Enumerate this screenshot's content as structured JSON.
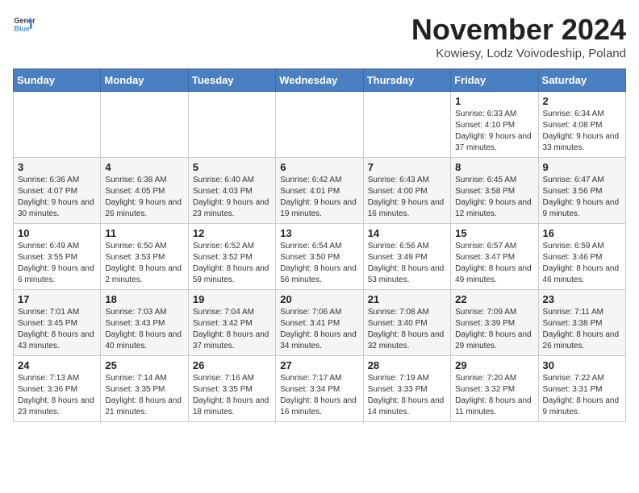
{
  "header": {
    "logo": "GeneralBlue",
    "title": "November 2024",
    "location": "Kowiesy, Lodz Voivodeship, Poland"
  },
  "days_of_week": [
    "Sunday",
    "Monday",
    "Tuesday",
    "Wednesday",
    "Thursday",
    "Friday",
    "Saturday"
  ],
  "weeks": [
    [
      {
        "day": "",
        "content": ""
      },
      {
        "day": "",
        "content": ""
      },
      {
        "day": "",
        "content": ""
      },
      {
        "day": "",
        "content": ""
      },
      {
        "day": "",
        "content": ""
      },
      {
        "day": "1",
        "content": "Sunrise: 6:33 AM\nSunset: 4:10 PM\nDaylight: 9 hours and 37 minutes."
      },
      {
        "day": "2",
        "content": "Sunrise: 6:34 AM\nSunset: 4:08 PM\nDaylight: 9 hours and 33 minutes."
      }
    ],
    [
      {
        "day": "3",
        "content": "Sunrise: 6:36 AM\nSunset: 4:07 PM\nDaylight: 9 hours and 30 minutes."
      },
      {
        "day": "4",
        "content": "Sunrise: 6:38 AM\nSunset: 4:05 PM\nDaylight: 9 hours and 26 minutes."
      },
      {
        "day": "5",
        "content": "Sunrise: 6:40 AM\nSunset: 4:03 PM\nDaylight: 9 hours and 23 minutes."
      },
      {
        "day": "6",
        "content": "Sunrise: 6:42 AM\nSunset: 4:01 PM\nDaylight: 9 hours and 19 minutes."
      },
      {
        "day": "7",
        "content": "Sunrise: 6:43 AM\nSunset: 4:00 PM\nDaylight: 9 hours and 16 minutes."
      },
      {
        "day": "8",
        "content": "Sunrise: 6:45 AM\nSunset: 3:58 PM\nDaylight: 9 hours and 12 minutes."
      },
      {
        "day": "9",
        "content": "Sunrise: 6:47 AM\nSunset: 3:56 PM\nDaylight: 9 hours and 9 minutes."
      }
    ],
    [
      {
        "day": "10",
        "content": "Sunrise: 6:49 AM\nSunset: 3:55 PM\nDaylight: 9 hours and 6 minutes."
      },
      {
        "day": "11",
        "content": "Sunrise: 6:50 AM\nSunset: 3:53 PM\nDaylight: 9 hours and 2 minutes."
      },
      {
        "day": "12",
        "content": "Sunrise: 6:52 AM\nSunset: 3:52 PM\nDaylight: 8 hours and 59 minutes."
      },
      {
        "day": "13",
        "content": "Sunrise: 6:54 AM\nSunset: 3:50 PM\nDaylight: 8 hours and 56 minutes."
      },
      {
        "day": "14",
        "content": "Sunrise: 6:56 AM\nSunset: 3:49 PM\nDaylight: 8 hours and 53 minutes."
      },
      {
        "day": "15",
        "content": "Sunrise: 6:57 AM\nSunset: 3:47 PM\nDaylight: 8 hours and 49 minutes."
      },
      {
        "day": "16",
        "content": "Sunrise: 6:59 AM\nSunset: 3:46 PM\nDaylight: 8 hours and 46 minutes."
      }
    ],
    [
      {
        "day": "17",
        "content": "Sunrise: 7:01 AM\nSunset: 3:45 PM\nDaylight: 8 hours and 43 minutes."
      },
      {
        "day": "18",
        "content": "Sunrise: 7:03 AM\nSunset: 3:43 PM\nDaylight: 8 hours and 40 minutes."
      },
      {
        "day": "19",
        "content": "Sunrise: 7:04 AM\nSunset: 3:42 PM\nDaylight: 8 hours and 37 minutes."
      },
      {
        "day": "20",
        "content": "Sunrise: 7:06 AM\nSunset: 3:41 PM\nDaylight: 8 hours and 34 minutes."
      },
      {
        "day": "21",
        "content": "Sunrise: 7:08 AM\nSunset: 3:40 PM\nDaylight: 8 hours and 32 minutes."
      },
      {
        "day": "22",
        "content": "Sunrise: 7:09 AM\nSunset: 3:39 PM\nDaylight: 8 hours and 29 minutes."
      },
      {
        "day": "23",
        "content": "Sunrise: 7:11 AM\nSunset: 3:38 PM\nDaylight: 8 hours and 26 minutes."
      }
    ],
    [
      {
        "day": "24",
        "content": "Sunrise: 7:13 AM\nSunset: 3:36 PM\nDaylight: 8 hours and 23 minutes."
      },
      {
        "day": "25",
        "content": "Sunrise: 7:14 AM\nSunset: 3:35 PM\nDaylight: 8 hours and 21 minutes."
      },
      {
        "day": "26",
        "content": "Sunrise: 7:16 AM\nSunset: 3:35 PM\nDaylight: 8 hours and 18 minutes."
      },
      {
        "day": "27",
        "content": "Sunrise: 7:17 AM\nSunset: 3:34 PM\nDaylight: 8 hours and 16 minutes."
      },
      {
        "day": "28",
        "content": "Sunrise: 7:19 AM\nSunset: 3:33 PM\nDaylight: 8 hours and 14 minutes."
      },
      {
        "day": "29",
        "content": "Sunrise: 7:20 AM\nSunset: 3:32 PM\nDaylight: 8 hours and 11 minutes."
      },
      {
        "day": "30",
        "content": "Sunrise: 7:22 AM\nSunset: 3:31 PM\nDaylight: 8 hours and 9 minutes."
      }
    ]
  ]
}
